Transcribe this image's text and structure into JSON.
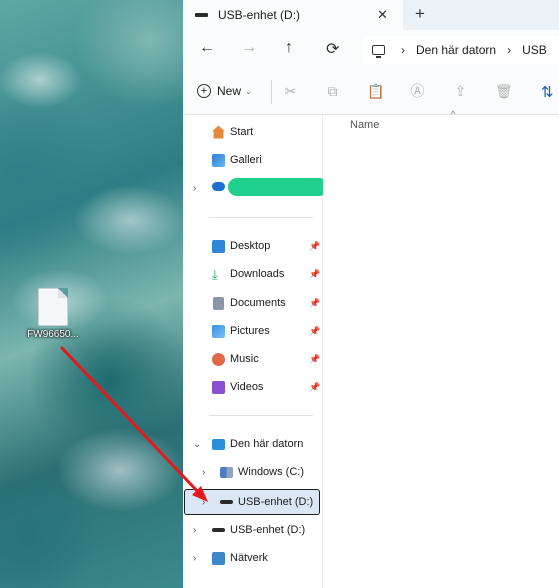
{
  "desktop": {
    "file_label": "FW96650..."
  },
  "window": {
    "tab_title": "USB-enhet (D:)",
    "tab_close": "✕",
    "new_tab": "+"
  },
  "nav": {
    "back": "←",
    "forward": "→",
    "up": "↑",
    "refresh": "⟳",
    "chevron": "›",
    "crumbs": [
      "Den här datorn",
      "USB"
    ]
  },
  "toolbar": {
    "new_label": "New",
    "new_plus": "+",
    "new_caret": "⌄",
    "icons": [
      "cut-icon",
      "copy-icon",
      "paste-icon",
      "rename-icon",
      "share-icon",
      "delete-icon"
    ],
    "sort_glyph": "⇅"
  },
  "sidebar": {
    "items": [
      {
        "label": "Start",
        "icon": "home-icon"
      },
      {
        "label": "Galleri",
        "icon": "gallery-icon"
      },
      {
        "label": "",
        "icon": "onedrive-icon",
        "expander": "›"
      },
      {
        "label": "Desktop",
        "icon": "desktop-icon",
        "pin": "📌"
      },
      {
        "label": "Downloads",
        "icon": "download-icon",
        "pin": "📌"
      },
      {
        "label": "Documents",
        "icon": "documents-icon",
        "pin": "📌"
      },
      {
        "label": "Pictures",
        "icon": "pictures-icon",
        "pin": "📌"
      },
      {
        "label": "Music",
        "icon": "music-icon",
        "pin": "📌"
      },
      {
        "label": "Videos",
        "icon": "videos-icon",
        "pin": "📌"
      },
      {
        "label": "Den här datorn",
        "icon": "computer-icon",
        "expander": "⌄"
      },
      {
        "label": "Windows (C:)",
        "icon": "windows-drive-icon",
        "expander": "›"
      },
      {
        "label": "USB-enhet (D:)",
        "icon": "usb-drive-icon",
        "expander": "›"
      },
      {
        "label": "USB-enhet (D:)",
        "icon": "usb-drive-icon",
        "expander": "›"
      },
      {
        "label": "Nätverk",
        "icon": "network-icon",
        "expander": "›"
      }
    ]
  },
  "content": {
    "column_name": "Name",
    "sort_caret": "^"
  },
  "colors": {
    "accent": "#1a5fb4",
    "arrow": "#e3191c",
    "selection": "#dbe7f4",
    "redaction": "#1fd08c"
  }
}
